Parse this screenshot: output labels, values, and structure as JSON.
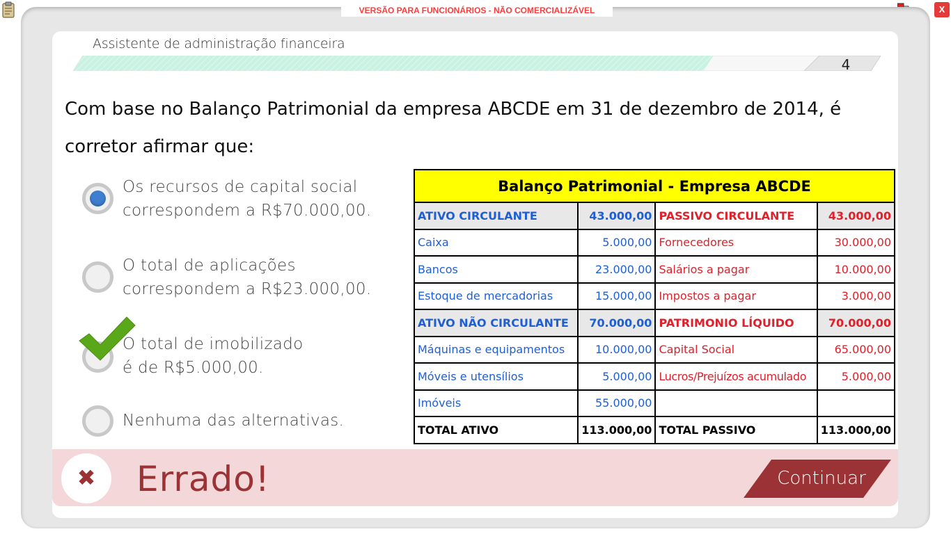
{
  "window": {
    "watermark": "VERSÃO PARA FUNCIONÁRIOS - NÃO COMERCIALIZÁVEL",
    "close_label": "X"
  },
  "header": {
    "course_title": "Assistente de administração financeira",
    "page_number": "4",
    "progress_fraction": 0.8
  },
  "question": {
    "text": "Com base no Balanço Patrimonial da empresa ABCDE em 31 de dezembro de 2014, é corretor afirmar que:"
  },
  "options": [
    {
      "line1": "Os recursos de capital social",
      "line2": "correspondem a R$70.000,00.",
      "selected": true,
      "correct": false
    },
    {
      "line1": "O total de aplicações",
      "line2": "correspondem a R$23.000,00.",
      "selected": false,
      "correct": false
    },
    {
      "line1": "O total de imobilizado",
      "line2": "é de R$5.000,00.",
      "selected": false,
      "correct": true
    },
    {
      "line1": "Nenhuma das alternativas.",
      "line2": "",
      "selected": false,
      "correct": false
    }
  ],
  "balance_sheet": {
    "title": "Balanço Patrimonial - Empresa ABCDE",
    "rows": [
      {
        "a_label": "ATIVO CIRCULANTE",
        "a_value": "43.000,00",
        "p_label": "PASSIVO CIRCULANTE",
        "p_value": "43.000,00"
      },
      {
        "a_label": "Caixa",
        "a_value": "5.000,00",
        "p_label": "Fornecedores",
        "p_value": "30.000,00"
      },
      {
        "a_label": "Bancos",
        "a_value": "23.000,00",
        "p_label": "Salários a pagar",
        "p_value": "10.000,00"
      },
      {
        "a_label": "Estoque de mercadorias",
        "a_value": "15.000,00",
        "p_label": "Impostos a pagar",
        "p_value": "3.000,00"
      },
      {
        "a_label": "ATIVO NÃO CIRCULANTE",
        "a_value": "70.000,00",
        "p_label": "PATRIMONIO LÍQUIDO",
        "p_value": "70.000,00"
      },
      {
        "a_label": "Máquinas e equipamentos",
        "a_value": "10.000,00",
        "p_label": "Capital Social",
        "p_value": "65.000,00"
      },
      {
        "a_label": "Móveis e utensílios",
        "a_value": "5.000,00",
        "p_label": "Lucros/Prejuízos acumulado",
        "p_value": "5.000,00"
      },
      {
        "a_label": "Imóveis",
        "a_value": "55.000,00",
        "p_label": "",
        "p_value": ""
      },
      {
        "a_label": "TOTAL ATIVO",
        "a_value": "113.000,00",
        "p_label": "TOTAL PASSIVO",
        "p_value": "113.000,00"
      }
    ]
  },
  "feedback": {
    "result": "Errado!",
    "icon_symbol": "✖",
    "continue_label": "Continuar"
  },
  "colors": {
    "feedback_bg": "#f4d7d8",
    "feedback_text": "#9b3336",
    "continue_bg": "#9b3336",
    "progress_fill": "#c9f2e3",
    "table_header_bg": "#ffff00",
    "asset_text": "#1f5fd6",
    "liability_text": "#e0202a",
    "check_green": "#5aa81a",
    "radio_selected": "#3f7fd0"
  }
}
